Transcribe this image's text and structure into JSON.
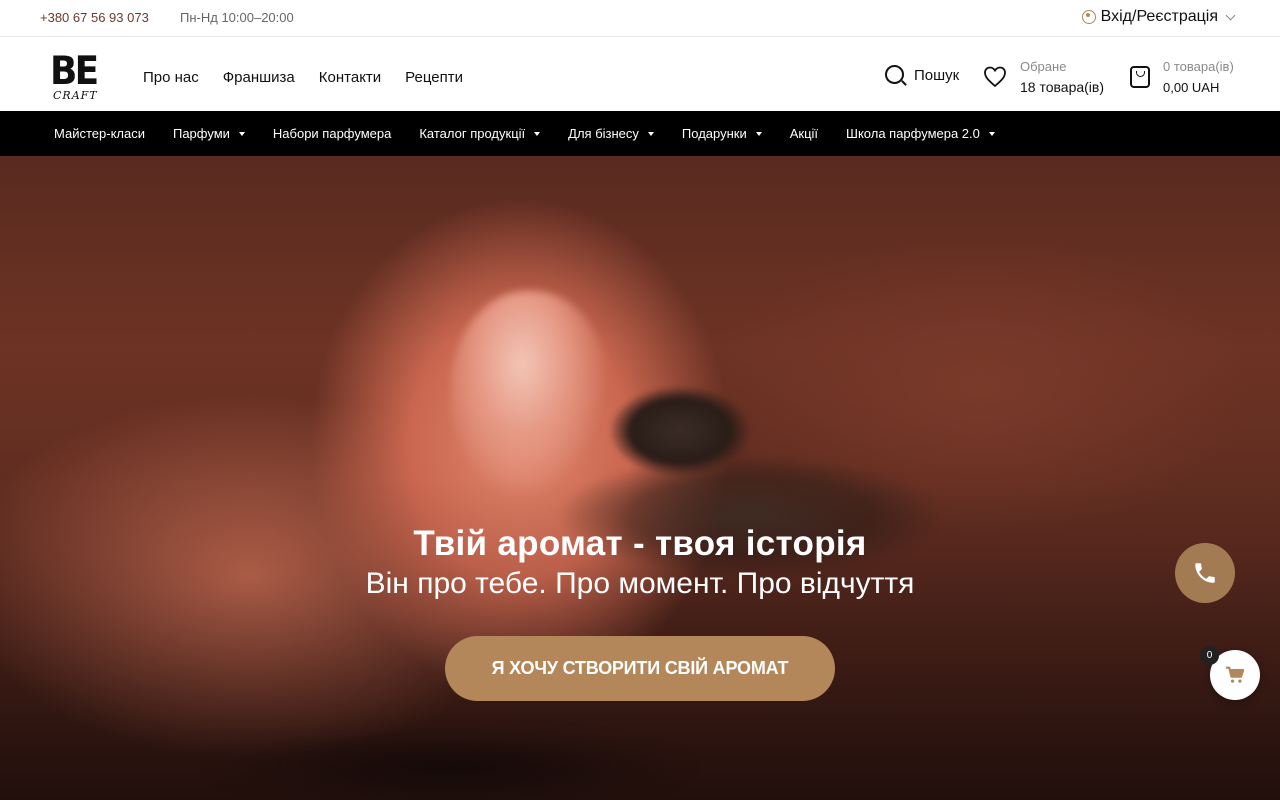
{
  "topbar": {
    "phone": "+380 67 56 93 073",
    "hours": "Пн-Нд 10:00–20:00",
    "login": "Вхід/Реєстрація"
  },
  "header": {
    "logo_top": "BE",
    "logo_bottom": "CRAFT",
    "nav": [
      "Про нас",
      "Франшиза",
      "Контакти",
      "Рецепти"
    ],
    "search": "Пошук",
    "favorites": {
      "label": "Обране",
      "count": "18 товара(ів)"
    },
    "cart": {
      "count": "0 товара(ів)",
      "total": "0,00 UAH"
    }
  },
  "catnav": [
    {
      "label": "Майстер-класи",
      "dropdown": false
    },
    {
      "label": "Парфуми",
      "dropdown": true
    },
    {
      "label": "Набори парфумера",
      "dropdown": false
    },
    {
      "label": "Каталог продукції",
      "dropdown": true
    },
    {
      "label": "Для бізнесу",
      "dropdown": true
    },
    {
      "label": "Подарунки",
      "dropdown": true
    },
    {
      "label": "Акції",
      "dropdown": false
    },
    {
      "label": "Школа парфумера 2.0",
      "dropdown": true
    }
  ],
  "hero": {
    "title": "Твій аромат - твоя історія",
    "subtitle": "Він про тебе. Про момент. Про відчуття",
    "cta": "Я ХОЧУ СТВОРИТИ СВІЙ АРОМАТ"
  },
  "floating": {
    "cart_badge": "0"
  },
  "colors": {
    "accent": "#b4875a",
    "phone_text": "#6b3a2c",
    "catnav_bg": "#000000"
  }
}
